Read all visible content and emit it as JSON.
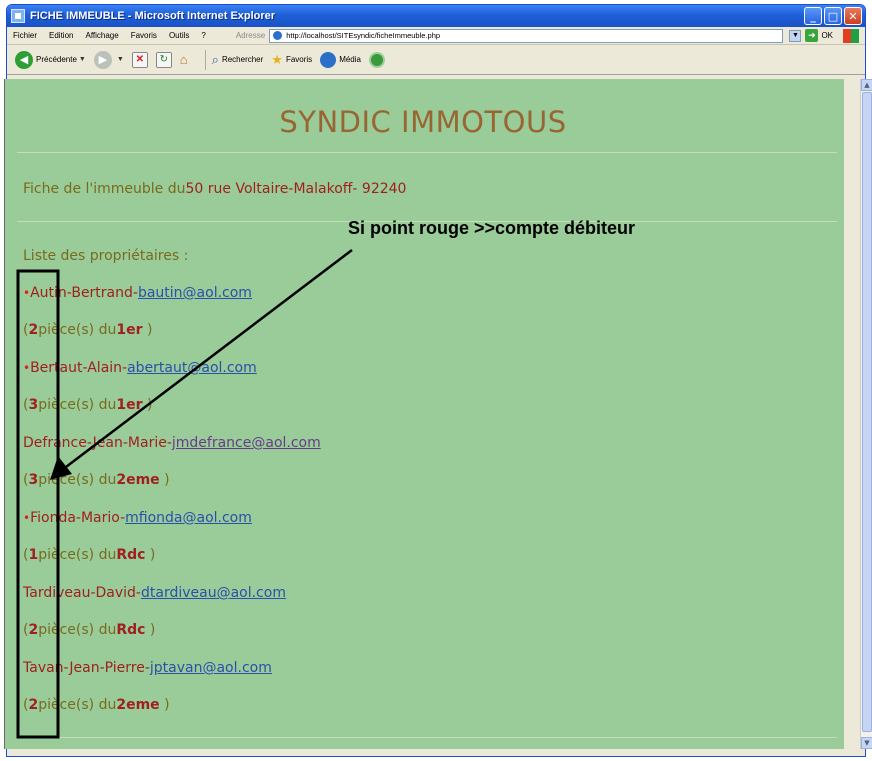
{
  "window": {
    "title": "FICHE IMMEUBLE - Microsoft Internet Explorer",
    "minimize": "_",
    "maximize": "□",
    "close": "✕"
  },
  "menu": {
    "items": [
      "Fichier",
      "Edition",
      "Affichage",
      "Favoris",
      "Outils",
      "?"
    ],
    "address_label": "Adresse",
    "address_url": "http://localhost/SITEsyndic/ficheImmeuble.php",
    "go_label": "OK"
  },
  "toolbar": {
    "back_label": "Précédente",
    "search_label": "Rechercher",
    "favorites_label": "Favoris",
    "media_label": "Média"
  },
  "page": {
    "site_title": "SYNDIC IMMOTOUS",
    "fiche_prefix": "Fiche de l'immeuble du",
    "address": "50 rue Voltaire-Malakoff- 92240",
    "owners_heading": "Liste des propriétaires :",
    "owners": [
      {
        "debtor": true,
        "name": "Autin-Bertrand-",
        "email": "bautin@aol.com",
        "open": "(",
        "rooms": "2",
        "mid": "pièce(s) du",
        "floor": "1er",
        "close": " )"
      },
      {
        "debtor": true,
        "name": "Bertaut-Alain-",
        "email": "abertaut@aol.com",
        "open": "(",
        "rooms": "3",
        "mid": "pièce(s) du",
        "floor": "1er",
        "close": " )"
      },
      {
        "debtor": false,
        "name": "Defrance-Jean-Marie-",
        "email": "jmdefrance@aol.com",
        "open": "(",
        "rooms": "3",
        "mid": "pièce(s) du",
        "floor": "2eme",
        "close": " )"
      },
      {
        "debtor": true,
        "name": "Fionda-Mario-",
        "email": "mfionda@aol.com",
        "open": "(",
        "rooms": "1",
        "mid": "pièce(s) du",
        "floor": "Rdc",
        "close": " )"
      },
      {
        "debtor": false,
        "name": "Tardiveau-David-",
        "email": "dtardiveau@aol.com",
        "open": "(",
        "rooms": "2",
        "mid": "pièce(s) du",
        "floor": "Rdc",
        "close": " )"
      },
      {
        "debtor": false,
        "name": "Tavan-Jean-Pierre-",
        "email": "jptavan@aol.com",
        "open": "(",
        "rooms": "2",
        "mid": "pièce(s) du",
        "floor": "2eme",
        "close": " )"
      }
    ],
    "debtor_dot": "•"
  },
  "annotation": {
    "text": "Si point rouge >>compte débiteur"
  },
  "colors": {
    "page_bg": "#99cc99",
    "title": "#996633",
    "label": "#7a6a1e",
    "name": "#a02020",
    "link": "#2b50a8",
    "debtor_dot": "#e02020"
  }
}
